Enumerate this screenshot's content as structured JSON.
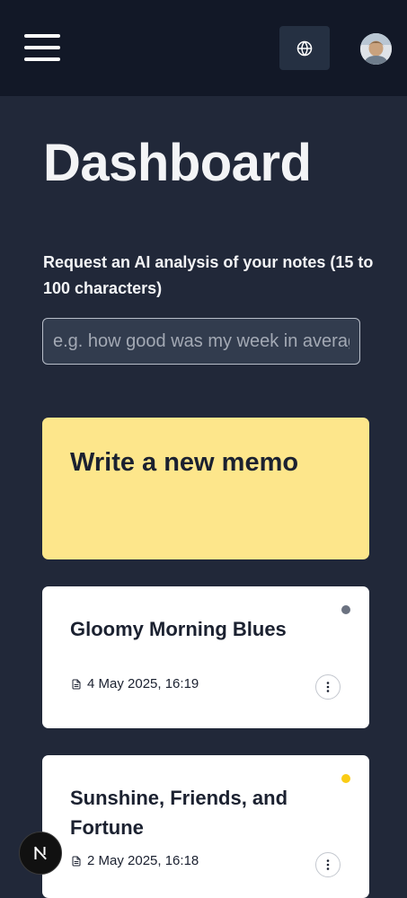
{
  "header": {
    "menu_icon": "hamburger-menu-icon",
    "language_icon": "globe-icon",
    "avatar_icon": "user-avatar"
  },
  "page": {
    "title": "Dashboard"
  },
  "analysis": {
    "label": "Request an AI analysis of your notes (15 to 100 characters)",
    "placeholder": "e.g. how good was my week in average?",
    "value": ""
  },
  "new_memo": {
    "label": "Write a new memo",
    "color": "#fde68b"
  },
  "memos": [
    {
      "title": "Gloomy Morning Blues",
      "date": "4 May 2025, 16:19",
      "mood_color": "#6b7280"
    },
    {
      "title": "Sunshine, Friends, and Fortune",
      "date": "2 May 2025, 16:18",
      "mood_color": "#facc15"
    }
  ],
  "dev_badge": {
    "label": "N"
  },
  "colors": {
    "background": "#212839",
    "header": "#121827",
    "accent_yellow": "#fde68b"
  }
}
